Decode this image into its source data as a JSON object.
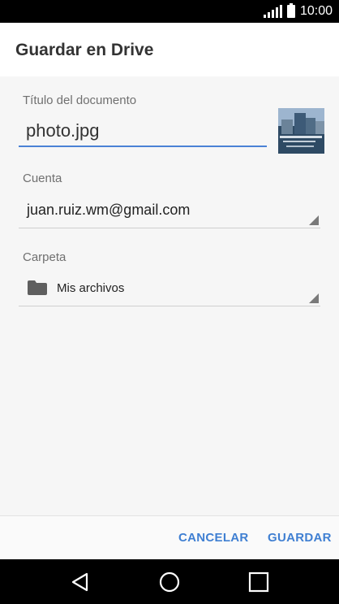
{
  "status_bar": {
    "time": "10:00",
    "icons": [
      "signal-icon",
      "battery-icon"
    ]
  },
  "header": {
    "title": "Guardar en Drive"
  },
  "form": {
    "title_label": "Título del documento",
    "title_value": "photo.jpg",
    "account_label": "Cuenta",
    "account_value": "juan.ruiz.wm@gmail.com",
    "folder_label": "Carpeta",
    "folder_value": "Mis archivos"
  },
  "actions": {
    "cancel": "CANCELAR",
    "save": "GUARDAR"
  },
  "colors": {
    "accent": "#3f7fd2",
    "underline": "#4a82d6",
    "status_bar": "#000000"
  },
  "nav": {
    "icons": [
      "back-icon",
      "home-icon",
      "recents-icon"
    ]
  }
}
